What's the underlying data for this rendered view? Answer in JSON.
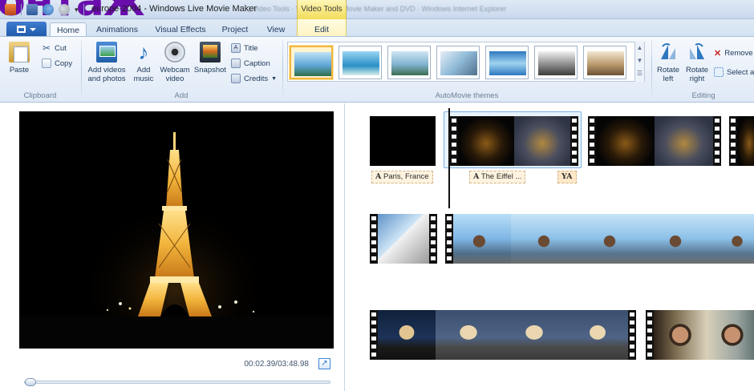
{
  "overlay": {
    "text": "онтаж"
  },
  "window": {
    "title": "europe-2004 - Windows Live Movie Maker",
    "background_title_faded": "| Video Tools   ·   Windows Live Movie Maker and DVD  ·  Windows Internet Explorer"
  },
  "context_group": {
    "label": "Video Tools"
  },
  "tabs": {
    "home": "Home",
    "animations": "Animations",
    "visual_effects": "Visual Effects",
    "project": "Project",
    "view": "View",
    "edit": "Edit"
  },
  "ribbon": {
    "clipboard": {
      "label": "Clipboard",
      "paste": "Paste",
      "cut": "Cut",
      "copy": "Copy"
    },
    "add": {
      "label": "Add",
      "add_videos_line1": "Add videos",
      "add_videos_line2": "and photos",
      "add_music_line1": "Add",
      "add_music_line2": "music",
      "webcam_line1": "Webcam",
      "webcam_line2": "video",
      "snapshot": "Snapshot",
      "title": "Title",
      "caption": "Caption",
      "credits": "Credits"
    },
    "automovie_themes": {
      "label": "AutoMovie themes",
      "selected_index": 0,
      "count": 7
    },
    "editing": {
      "label": "Editing",
      "rotate_left_line1": "Rotate",
      "rotate_left_line2": "left",
      "rotate_right_line1": "Rotate",
      "rotate_right_line2": "right",
      "remove": "Remove",
      "select_all": "Select a"
    }
  },
  "preview": {
    "time": "00:02.39/03:48.98",
    "seek_position": 0.01
  },
  "storyboard": {
    "captions": [
      {
        "text": "Paris, France"
      },
      {
        "text": "The Eiffel ..."
      },
      {
        "text": ""
      }
    ]
  },
  "colors": {
    "accent": "#1f58a8",
    "overlay_text": "#6a0dad",
    "context_tab": "#f3dc5a",
    "selection": "#7db0e8"
  }
}
